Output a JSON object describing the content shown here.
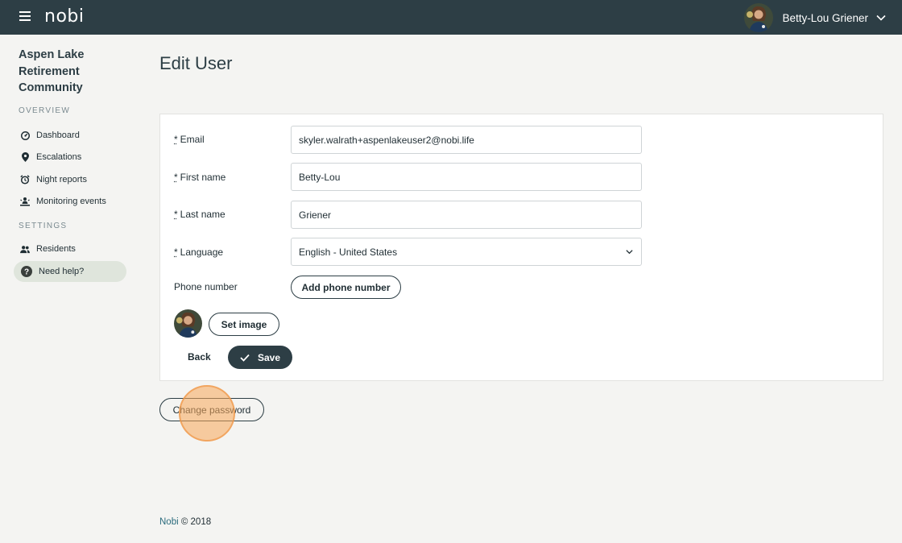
{
  "header": {
    "logo": "nobi",
    "user_name": "Betty-Lou Griener"
  },
  "sidebar": {
    "org_name": "Aspen Lake Retirement Community",
    "overview_label": "OVERVIEW",
    "settings_label": "SETTINGS",
    "overview_items": [
      {
        "label": "Dashboard",
        "icon": "dashboard-icon"
      },
      {
        "label": "Escalations",
        "icon": "location-pin-icon"
      },
      {
        "label": "Night reports",
        "icon": "alarm-clock-icon"
      },
      {
        "label": "Monitoring events",
        "icon": "monitor-person-icon"
      }
    ],
    "settings_items": [
      {
        "label": "Residents",
        "icon": "people-icon"
      },
      {
        "label": "Need help?",
        "icon": "help-icon",
        "active": true
      }
    ]
  },
  "page": {
    "title": "Edit User"
  },
  "form": {
    "required_mark": "*",
    "email_label": "Email",
    "email_value": "skyler.walrath+aspenlakeuser2@nobi.life",
    "first_name_label": "First name",
    "first_name_value": "Betty-Lou",
    "last_name_label": "Last name",
    "last_name_value": "Griener",
    "language_label": "Language",
    "language_value": "English - United States",
    "phone_label": "Phone number",
    "add_phone_label": "Add phone number",
    "set_image_label": "Set image",
    "back_label": "Back",
    "save_label": "Save"
  },
  "change_password_label": "Change password",
  "footer": {
    "brand": "Nobi",
    "copyright": "© 2018"
  },
  "colors": {
    "header_bg": "#2d3e45",
    "primary": "#2d3e45",
    "active_nav_bg": "#dfe5dc",
    "page_bg": "#f4f4f2",
    "click_indicator": "#f8a85a"
  }
}
